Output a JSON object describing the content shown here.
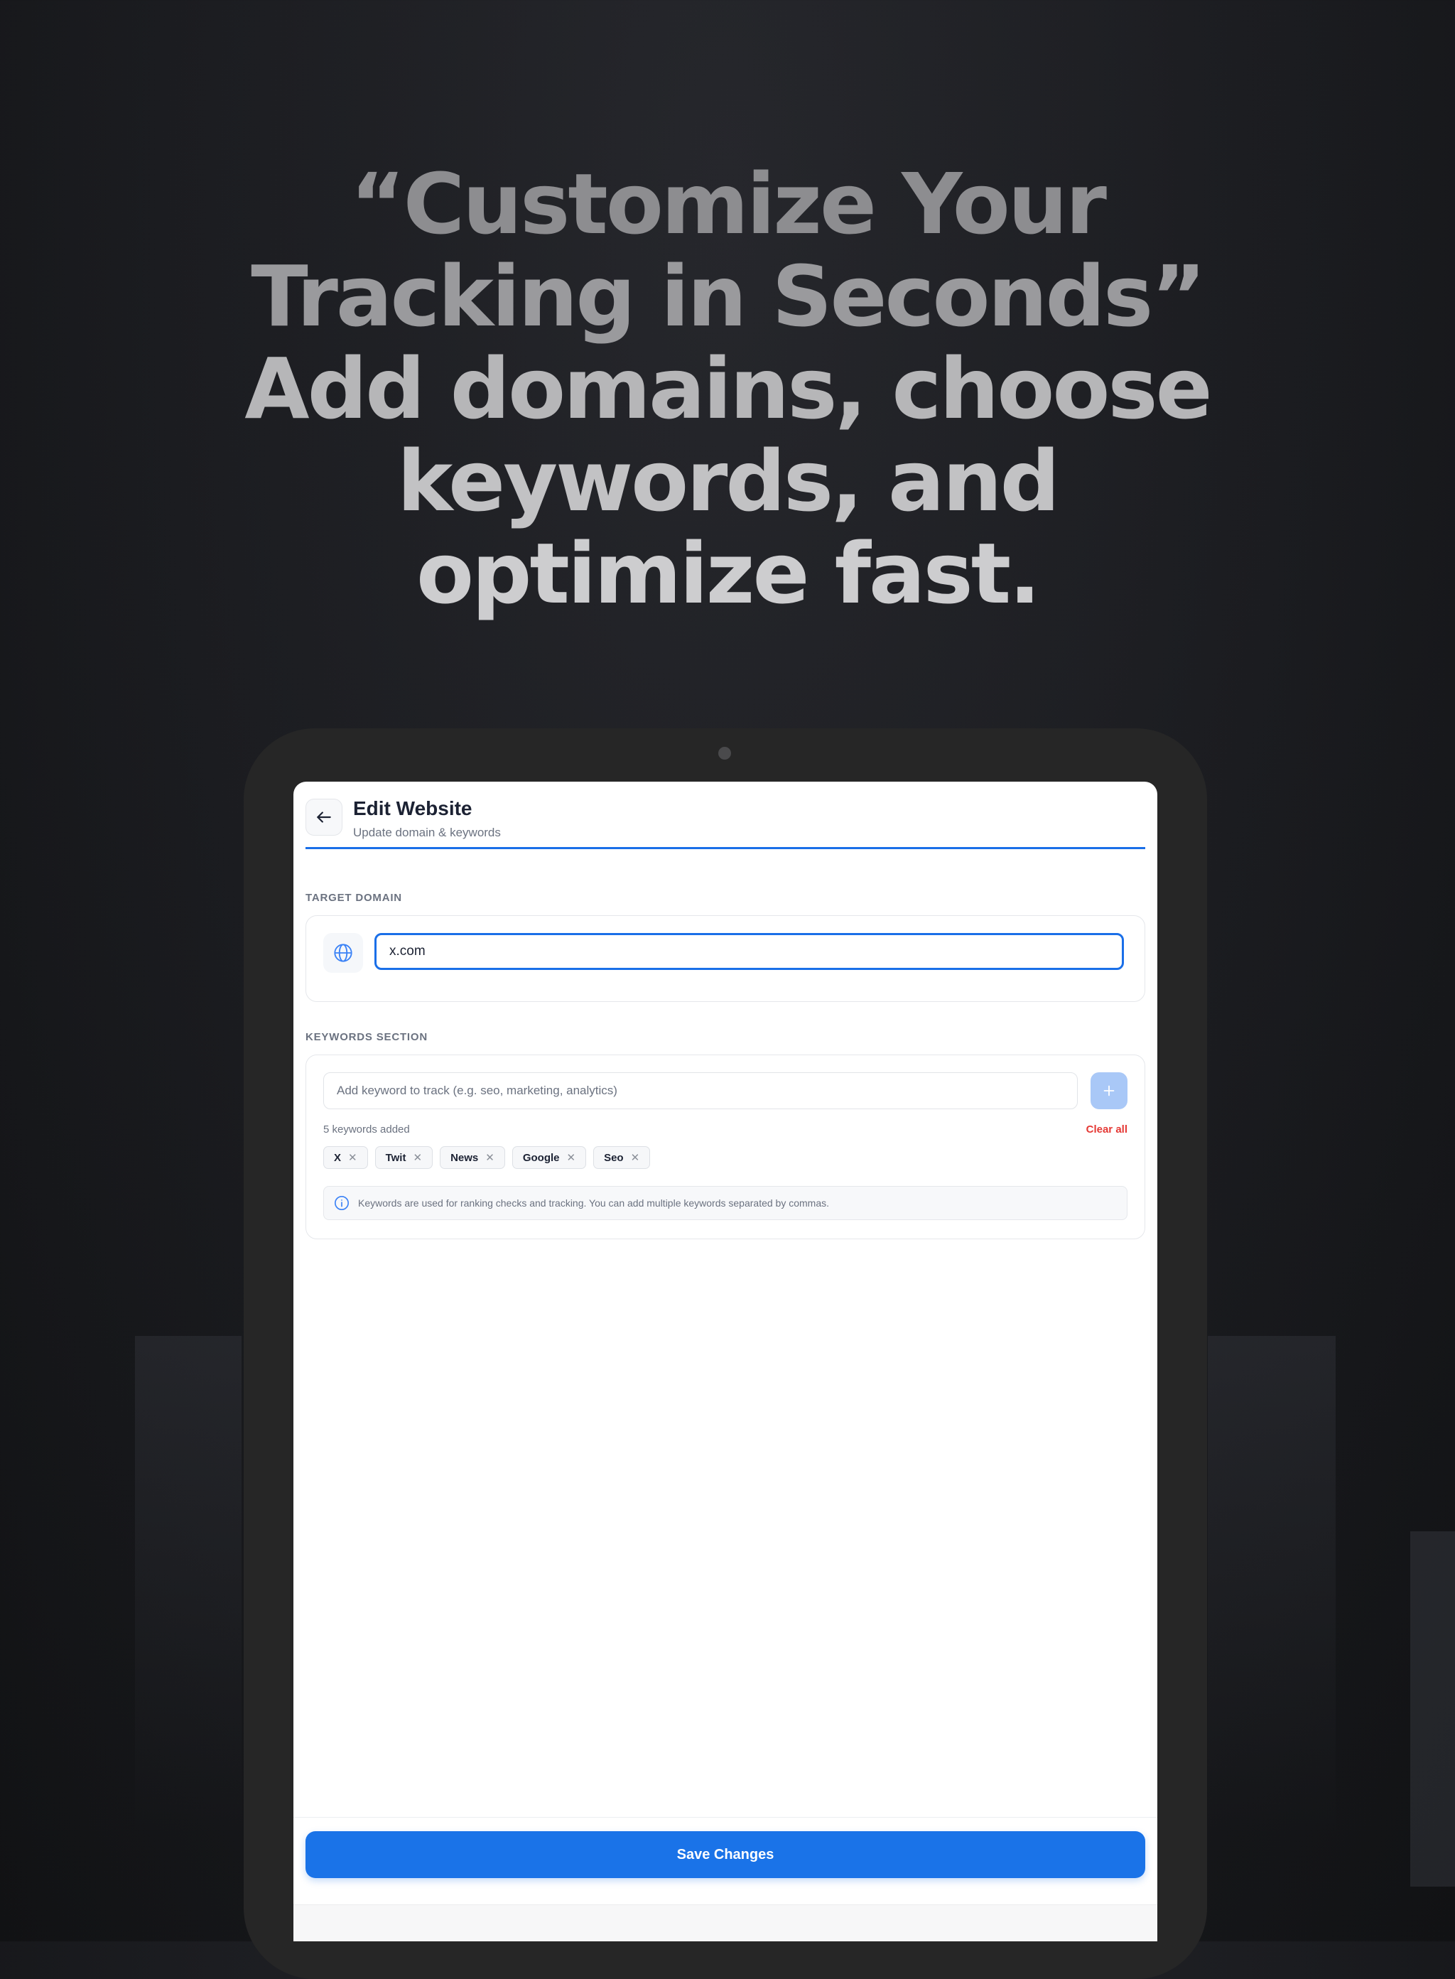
{
  "headline": {
    "line1": "“Customize Your",
    "line2": "Tracking in Seconds”",
    "line3": "Add domains, choose",
    "line4": "keywords, and",
    "line5": "optimize fast."
  },
  "header": {
    "title": "Edit Website",
    "subtitle": "Update domain & keywords",
    "back_icon": "arrow-left-icon"
  },
  "domain_section": {
    "label": "TARGET DOMAIN",
    "icon": "globe-icon",
    "value": "x.com"
  },
  "keywords_section": {
    "label": "KEYWORDS SECTION",
    "placeholder": "Add keyword to track (e.g. seo, marketing, analytics)",
    "add_icon": "plus-icon",
    "count_text": "5 keywords added",
    "clear_label": "Clear all",
    "chips": [
      "X",
      "Twit",
      "News",
      "Google",
      "Seo"
    ],
    "info_text": "Keywords are used for ranking checks and tracking. You can add multiple keywords separated by commas."
  },
  "footer": {
    "save_label": "Save Changes"
  },
  "colors": {
    "accent": "#1a73e8",
    "danger": "#e53935",
    "add_button": "#a9c8f7"
  }
}
